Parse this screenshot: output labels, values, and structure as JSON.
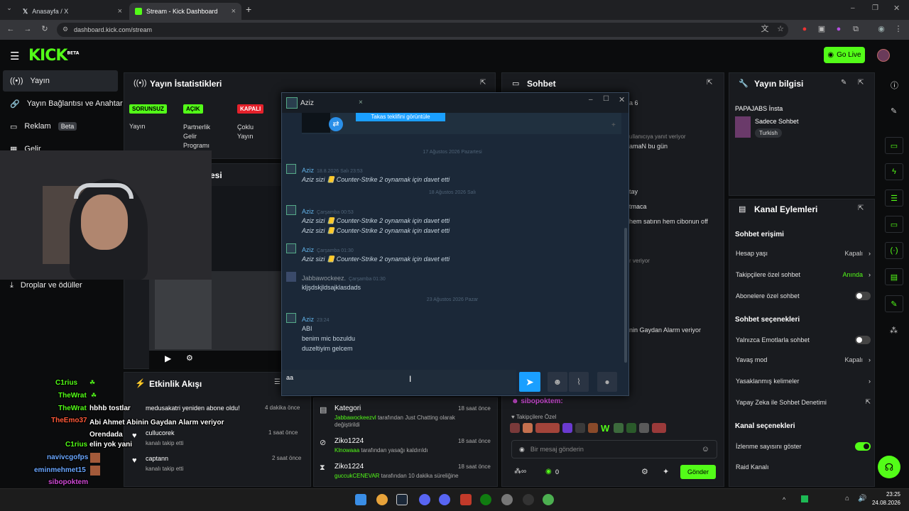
{
  "browser": {
    "tabs": [
      {
        "label": "Anasayfa / X"
      },
      {
        "label": "Stream - Kick Dashboard"
      }
    ],
    "url": "dashboard.kick.com/stream"
  },
  "header": {
    "logo": "KICK",
    "logo_tag": "BETA",
    "go_live": "Go Live"
  },
  "sidebar": {
    "items": [
      {
        "label": "Yayın"
      },
      {
        "label": "Yayın Bağlantısı ve Anahtar"
      },
      {
        "label": "Reklam",
        "badge": "Beta"
      },
      {
        "label": "Gelir"
      },
      {
        "label": "Droplar ve ödüller"
      }
    ]
  },
  "stats": {
    "title": "Yayın İstatistikleri",
    "pills": [
      {
        "badge": "SORUNSUZ",
        "label": "Yayın",
        "color": "#53fc18"
      },
      {
        "badge": "AÇIK",
        "label": "Partnerlik Gelir Programı",
        "color": "#53fc18"
      },
      {
        "badge": "KAPALI",
        "label": "Çoklu Yayın",
        "color": "#e5212b"
      }
    ]
  },
  "preview": {
    "title_fragment": "esi"
  },
  "sohbet": {
    "title": "Sohbet",
    "fragments": [
      "a 6",
      "ullanıcıya yanıt veriyor",
      "amaN bu gün",
      "tay",
      "tmaca",
      "hem satınn hem cibonun off",
      "r veriyor",
      "nin Gaydan Alarm veriyor"
    ],
    "pinned_user": "sibopoktem:",
    "followers_only": "Takipçilere Özel",
    "input_placeholder": "Bir mesaj gönderin",
    "count": "0",
    "send": "Gönder"
  },
  "steam_chat": {
    "title": "Aziz",
    "top_button": "Takas teklifini görüntüle",
    "separators": [
      "17 Ağustos 2026 Pazartesi",
      "18 Ağustos 2026 Salı",
      "23 Ağustos 2026 Pazar"
    ],
    "messages": [
      {
        "name": "Aziz",
        "time": "18.8.2026 Salı 23:53",
        "lines": [
          "Aziz sizi 📒 Counter-Strike 2 oynamak için davet etti"
        ]
      },
      {
        "name": "Aziz",
        "time": "Çarşamba 00:53",
        "lines": [
          "Aziz sizi 📒 Counter-Strike 2 oynamak için davet etti",
          "Aziz sizi 📒 Counter-Strike 2 oynamak için davet etti"
        ]
      },
      {
        "name": "Aziz",
        "time": "Çarşamba 01:30",
        "lines": [
          "Aziz sizi 📒 Counter-Strike 2 oynamak için davet etti"
        ]
      },
      {
        "name": "Jabbawockeez.",
        "time": "Çarşamba 01:30",
        "lines": [
          "kljşdskjldsajklasdads"
        ]
      },
      {
        "name": "Aziz",
        "time": "23:24",
        "lines": [
          "ABI",
          "benim mic bozuldu",
          "duzeltiyim gelcem"
        ]
      }
    ],
    "input_value": "aa"
  },
  "stream_info": {
    "title": "Yayın bilgisi",
    "stream_title": "PAPAJABS İnsta",
    "category": "Sadece Sohbet",
    "tag": "Turkish"
  },
  "channel": {
    "title": "Kanal Eylemleri",
    "chat_access": "Sohbet erişimi",
    "rows1": [
      {
        "label": "Hesap yaşı",
        "value": "Kapalı"
      },
      {
        "label": "Takipçilere özel sohbet",
        "value": "Anında"
      },
      {
        "label": "Abonelere özel sohbet",
        "toggle": "off"
      }
    ],
    "chat_options": "Sohbet seçenekleri",
    "rows2": [
      {
        "label": "Yalnızca Emotlarla sohbet",
        "toggle": "off"
      },
      {
        "label": "Yavaş mod",
        "value": "Kapalı"
      },
      {
        "label": "Yasaklanmış kelimeler"
      },
      {
        "label": "Yapay Zeka ile Sohbet Denetimi"
      }
    ],
    "channel_options": "Kanal seçenekleri",
    "rows3": [
      {
        "label": "İzlenme sayısını göster",
        "toggle": "on"
      },
      {
        "label": "Raid Kanalı"
      }
    ]
  },
  "activity": {
    "title": "Etkinlik Akışı",
    "items": [
      {
        "text": "medusakatri yeniden abone oldu!",
        "time": "4 dakika önce"
      },
      {
        "text": "cullucorek",
        "sub": "kanalı takip etti",
        "time": "1 saat önce"
      },
      {
        "text": "captann",
        "sub": "kanalı takip etti",
        "time": "2 saat önce"
      }
    ]
  },
  "moderation": {
    "items": [
      {
        "title": "Kategori",
        "time": "18 saat önce",
        "user": "Jabbawockeezvl",
        "sub": "tarafından Just Chatting olarak değiştirildi"
      },
      {
        "title": "Ziko1224",
        "time": "18 saat önce",
        "user": "Klnowaaa",
        "sub": "tarafından yasağı kaldırıldı"
      },
      {
        "title": "Ziko1224",
        "time": "18 saat önce",
        "user": "guccukCENEVAR",
        "sub": "tarafından 10 dakika süreliğine"
      }
    ]
  },
  "overlay_chat": [
    {
      "user": "C1rius",
      "msg": "",
      "color": "#53fc18"
    },
    {
      "user": "TheWrat",
      "msg": "",
      "color": "#53fc18"
    },
    {
      "user": "TheWrat",
      "msg": "hbhb tostlar",
      "color": "#53fc18"
    },
    {
      "user": "TheEmo37",
      "msg": "Abi Ahmet Abinin Gaydan Alarm veriyor Orendada",
      "color": "#ff5a3a"
    },
    {
      "user": "C1rius",
      "msg": "elin yok yani",
      "color": "#53fc18"
    },
    {
      "user": "navivcgofps",
      "msg": "",
      "color": "#6aa7ff"
    },
    {
      "user": "eminmehmet15",
      "msg": "",
      "color": "#6aa7ff"
    },
    {
      "user": "sibopoktem",
      "msg": "",
      "color": "#d04ad6"
    }
  ],
  "clock": {
    "time": "23:25",
    "date": "24.08.2026"
  }
}
